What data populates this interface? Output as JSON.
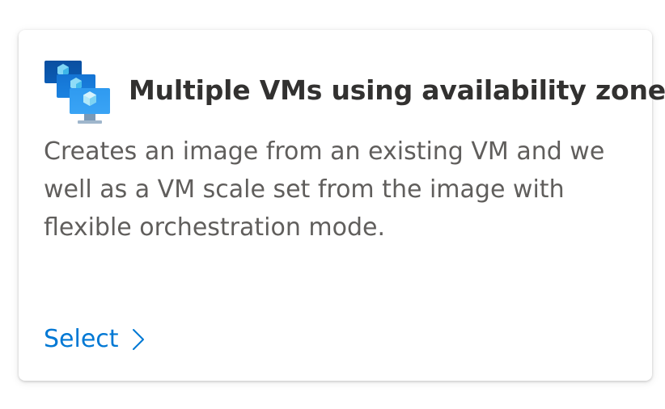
{
  "card": {
    "icon": "vm-scale-set-icon",
    "title": "Multiple VMs using availability zones",
    "description": "Creates an image from an existing VM and we well as a VM scale set from the image with flexible orchestration mode.",
    "select_label": "Select",
    "select_icon": "chevron-right-icon"
  },
  "colors": {
    "link": "#0078d4",
    "title": "#323130",
    "description": "#605e5c"
  }
}
